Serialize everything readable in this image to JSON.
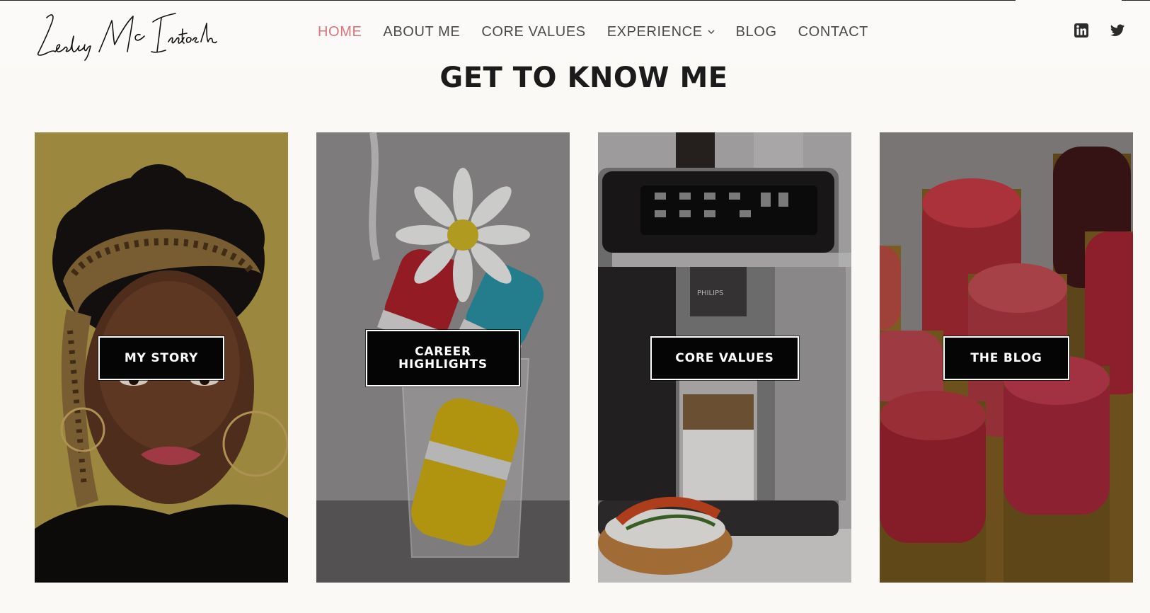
{
  "brand": {
    "logo_text": "Lesley McIntosh"
  },
  "nav": {
    "items": [
      {
        "label": "HOME",
        "active": true
      },
      {
        "label": "ABOUT ME",
        "active": false
      },
      {
        "label": "CORE VALUES",
        "active": false
      },
      {
        "label": "EXPERIENCE",
        "active": false,
        "has_dropdown": true
      },
      {
        "label": "BLOG",
        "active": false
      },
      {
        "label": "CONTACT",
        "active": false
      }
    ]
  },
  "social": [
    {
      "icon": "linkedin-icon"
    },
    {
      "icon": "twitter-icon"
    }
  ],
  "section": {
    "title": "GET TO KNOW ME"
  },
  "cards": [
    {
      "button_label": "MY STORY",
      "image": "portrait-woman-leopard-headband"
    },
    {
      "button_label": "CAREER HIGHLIGHTS",
      "image": "revlon-nail-polish-daisy-glass"
    },
    {
      "button_label": "CORE VALUES",
      "image": "philips-coffee-machine"
    },
    {
      "button_label": "THE BLOG",
      "image": "red-lipsticks"
    }
  ],
  "colors": {
    "accent": "#d9757a",
    "nav_text": "#4a4a4a",
    "title": "#1b1b1b",
    "page_bg": "#fbf9f6",
    "button_bg": "#050505"
  }
}
